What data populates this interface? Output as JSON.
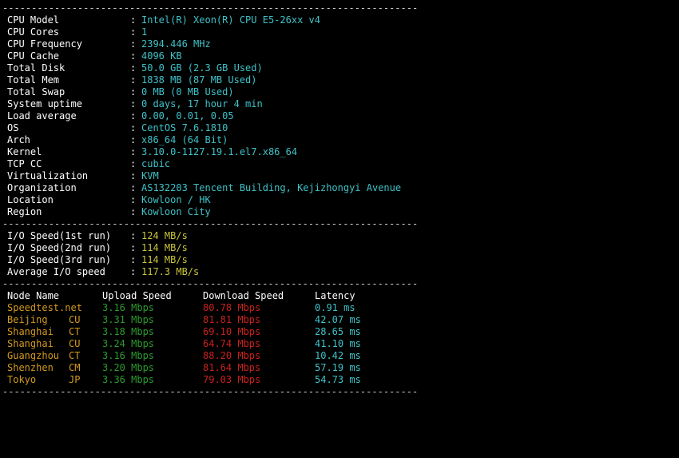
{
  "header_fragment": "----- --- - --- ------ - ----- ----- - - ----- - - --- --- - - --- -----",
  "separator": "------------------------------------------------------------------------",
  "colors": {
    "label": "#ffffff",
    "info_value": "#3fc2c8",
    "io_value": "#c9c53a",
    "node": "#d29a1e",
    "upload": "#2e9a2e",
    "download": "#c8201e",
    "latency": "#3fc2c8"
  },
  "system_info": [
    {
      "label": "CPU Model",
      "value": "Intel(R) Xeon(R) CPU E5-26xx v4"
    },
    {
      "label": "CPU Cores",
      "value": "1"
    },
    {
      "label": "CPU Frequency",
      "value": "2394.446 MHz"
    },
    {
      "label": "CPU Cache",
      "value": "4096 KB"
    },
    {
      "label": "Total Disk",
      "value": "50.0 GB (2.3 GB Used)"
    },
    {
      "label": "Total Mem",
      "value": "1838 MB (87 MB Used)"
    },
    {
      "label": "Total Swap",
      "value": "0 MB (0 MB Used)"
    },
    {
      "label": "System uptime",
      "value": "0 days, 17 hour 4 min"
    },
    {
      "label": "Load average",
      "value": "0.00, 0.01, 0.05"
    },
    {
      "label": "OS",
      "value": "CentOS 7.6.1810"
    },
    {
      "label": "Arch",
      "value": "x86_64 (64 Bit)"
    },
    {
      "label": "Kernel",
      "value": "3.10.0-1127.19.1.el7.x86_64"
    },
    {
      "label": "TCP CC",
      "value": "cubic"
    },
    {
      "label": "Virtualization",
      "value": "KVM"
    },
    {
      "label": "Organization",
      "value": "AS132203 Tencent Building, Kejizhongyi Avenue"
    },
    {
      "label": "Location",
      "value": "Kowloon / HK"
    },
    {
      "label": "Region",
      "value": "Kowloon City"
    }
  ],
  "io": [
    {
      "label": "I/O Speed(1st run)",
      "value": "124 MB/s"
    },
    {
      "label": "I/O Speed(2nd run)",
      "value": "114 MB/s"
    },
    {
      "label": "I/O Speed(3rd run)",
      "value": "114 MB/s"
    },
    {
      "label": "Average I/O speed",
      "value": "117.3 MB/s"
    }
  ],
  "speedtest": {
    "headers": {
      "node": "Node Name",
      "upload": "Upload Speed",
      "download": "Download Speed",
      "latency": "Latency"
    },
    "rows": [
      {
        "node": "Speedtest.net",
        "isp": "",
        "upload": "3.16 Mbps",
        "download": "80.78 Mbps",
        "latency": "0.91 ms"
      },
      {
        "node": "Beijing",
        "isp": "CU",
        "upload": "3.31 Mbps",
        "download": "81.81 Mbps",
        "latency": "42.07 ms"
      },
      {
        "node": "Shanghai",
        "isp": "CT",
        "upload": "3.18 Mbps",
        "download": "69.10 Mbps",
        "latency": "28.65 ms"
      },
      {
        "node": "Shanghai",
        "isp": "CU",
        "upload": "3.24 Mbps",
        "download": "64.74 Mbps",
        "latency": "41.10 ms"
      },
      {
        "node": "Guangzhou",
        "isp": "CT",
        "upload": "3.16 Mbps",
        "download": "88.20 Mbps",
        "latency": "10.42 ms"
      },
      {
        "node": "Shenzhen",
        "isp": "CM",
        "upload": "3.20 Mbps",
        "download": "81.64 Mbps",
        "latency": "57.19 ms"
      },
      {
        "node": "Tokyo",
        "isp": "JP",
        "upload": "3.36 Mbps",
        "download": "79.03 Mbps",
        "latency": "54.73 ms"
      }
    ]
  }
}
